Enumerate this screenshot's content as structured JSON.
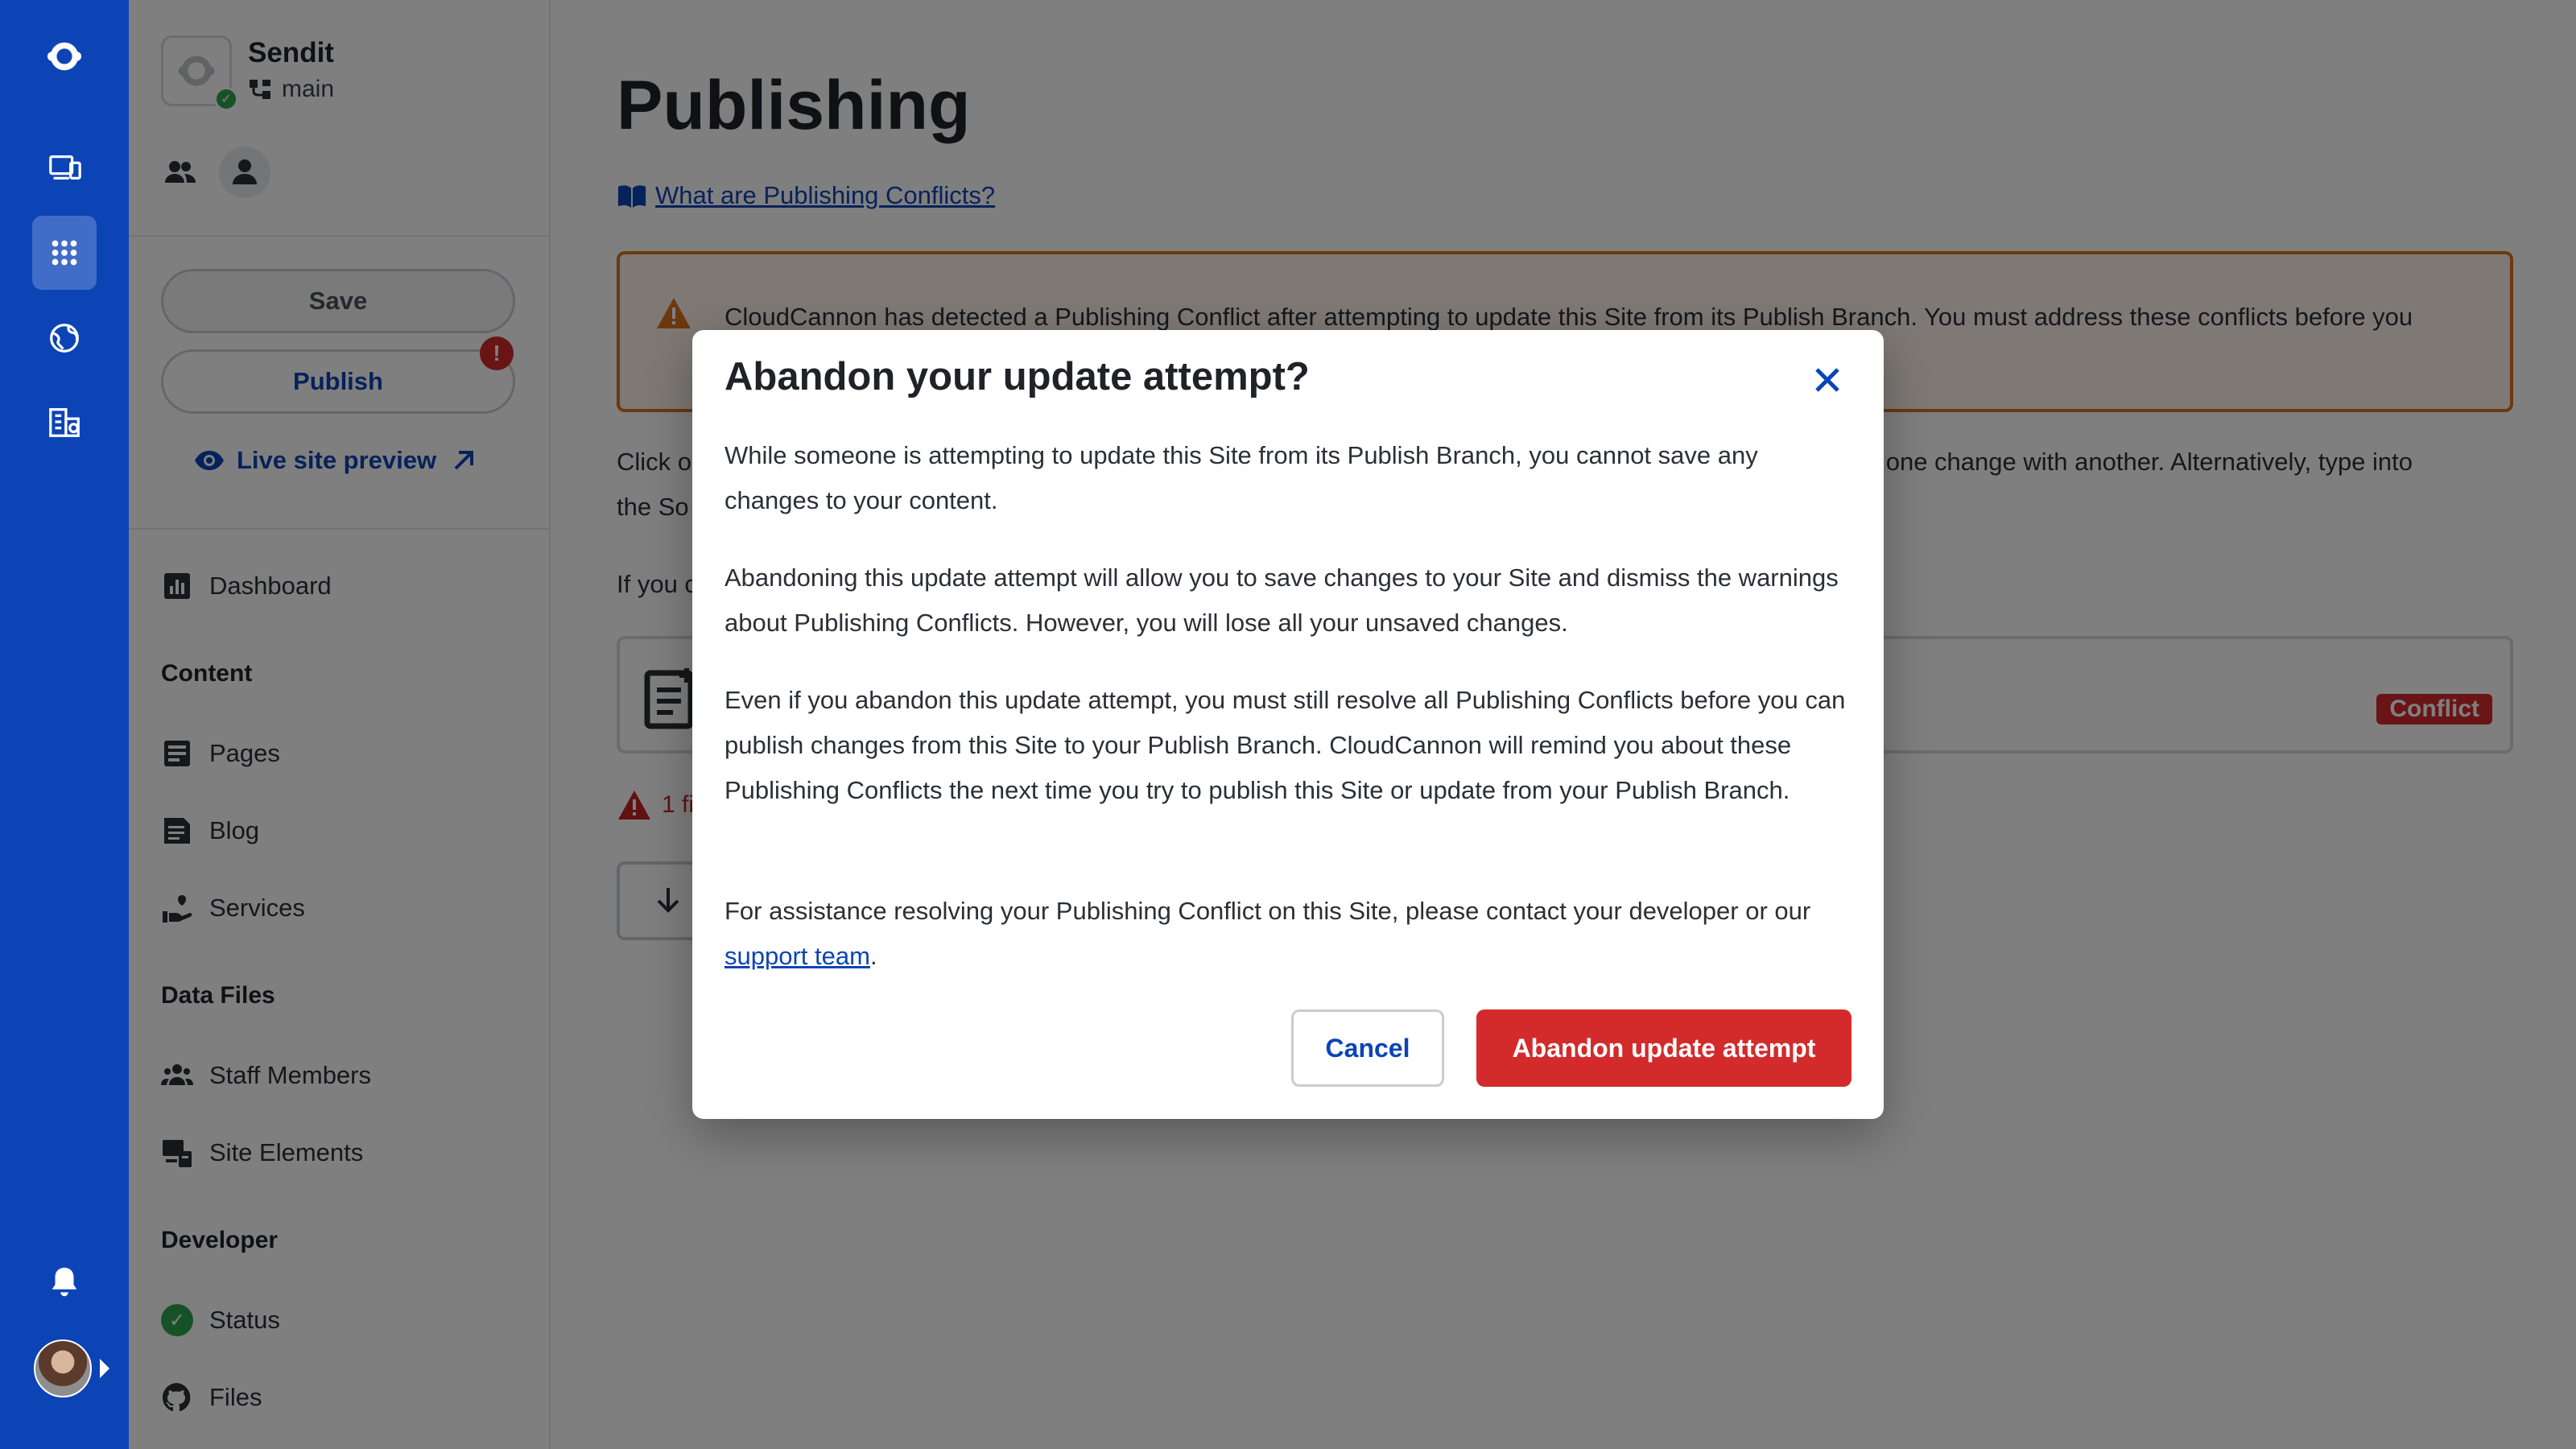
{
  "app": {
    "accent": "#0c44b6",
    "danger": "#d32b2b",
    "warning": "#d9731f"
  },
  "rail": {
    "icons": [
      "cloudcannon-logo-icon",
      "devices-icon",
      "apps-grid-icon",
      "globe-icon",
      "organization-icon",
      "bell-icon"
    ]
  },
  "site": {
    "name": "Sendit",
    "branch": "main"
  },
  "panel": {
    "save_label": "Save",
    "publish_label": "Publish",
    "publish_alert": "!",
    "live_preview_label": "Live site preview",
    "dashboard": "Dashboard",
    "content_heading": "Content",
    "content_items": [
      "Pages",
      "Blog",
      "Services"
    ],
    "data_heading": "Data Files",
    "data_items": [
      "Staff Members",
      "Site Elements"
    ],
    "developer_heading": "Developer",
    "developer_items": [
      "Status",
      "Files"
    ]
  },
  "main": {
    "title": "Publishing",
    "help_link": "What are Publishing Conflicts?",
    "warning_text": "CloudCannon has detected a Publishing Conflict after attempting to update this Site from its Publish Branch. You must address these conflicts before you",
    "click_text_left": "Click o",
    "click_text_right": "place one change with another. Alternatively, type into",
    "source_text_left": "the So",
    "if_text": "If you c",
    "conflict_badge": "Conflict",
    "files_warning_partial": "1 fil"
  },
  "modal": {
    "title": "Abandon your update attempt?",
    "p1": "While someone is attempting to update this Site from its Publish Branch, you cannot save any changes to your content.",
    "p2": "Abandoning this update attempt will allow you to save changes to your Site and dismiss the warnings about Publishing Conflicts. However, you will lose all your unsaved changes.",
    "p3": "Even if you abandon this update attempt, you must still resolve all Publishing Conflicts before you can publish changes from this Site to your Publish Branch. CloudCannon will remind you about these Publishing Conflicts the next time you try to publish this Site or update from your Publish Branch.",
    "p4_before": "For assistance resolving your Publishing Conflict on this Site, please contact your developer or our ",
    "p4_link": "support team",
    "p4_after": ".",
    "cancel_label": "Cancel",
    "abandon_label": "Abandon update attempt"
  }
}
